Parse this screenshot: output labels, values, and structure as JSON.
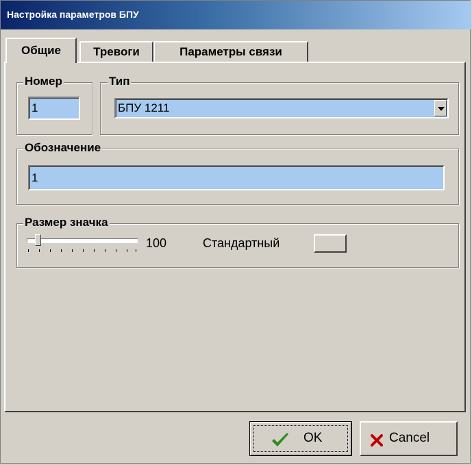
{
  "window": {
    "title": "Настройка параметров БПУ"
  },
  "tabs": [
    {
      "label": "Общие"
    },
    {
      "label": "Тревоги"
    },
    {
      "label": "Параметры связи"
    }
  ],
  "number_group": {
    "title": "Номер",
    "value": "1"
  },
  "type_group": {
    "title": "Тип",
    "selected": "БПУ 1211"
  },
  "designation_group": {
    "title": "Обозначение",
    "value": "1"
  },
  "icon_size_group": {
    "title": "Размер значка",
    "slider_value": "100",
    "slider_fraction": 0.08,
    "standard_label": "Стандартный"
  },
  "buttons": {
    "ok": "OK",
    "cancel": "Cancel"
  },
  "colors": {
    "field_bg": "#a6caf0",
    "face": "#d4d0c8",
    "ok_check": "#2e8b1f",
    "cancel_x": "#c00000"
  }
}
